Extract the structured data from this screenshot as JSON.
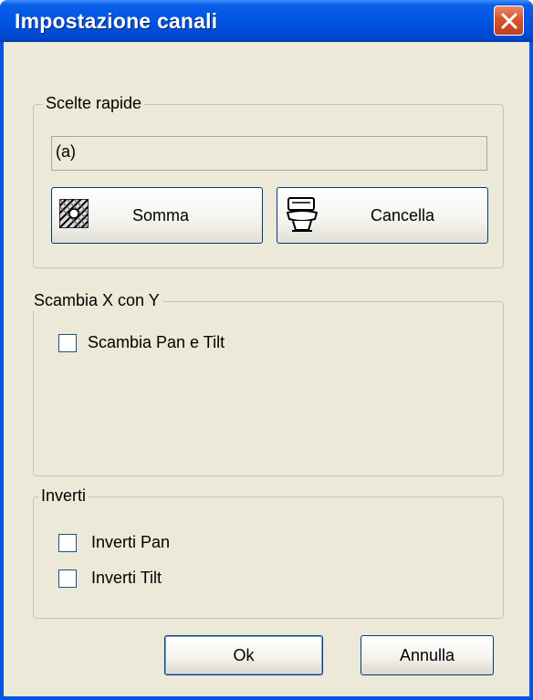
{
  "window": {
    "title": "Impostazione canali"
  },
  "quick_choices": {
    "legend": "Scelte rapide",
    "field_value": "(a)",
    "sum_button_label": "Somma",
    "clear_button_label": "Cancella"
  },
  "swap_xy": {
    "legend": "Scambia X con Y",
    "swap_pan_tilt_label": "Scambia Pan e Tilt",
    "swap_pan_tilt_checked": false
  },
  "invert": {
    "legend": "Inverti",
    "invert_pan_label": "Inverti Pan",
    "invert_pan_checked": false,
    "invert_tilt_label": "Inverti Tilt",
    "invert_tilt_checked": false
  },
  "footer": {
    "ok_label": "Ok",
    "cancel_label": "Annulla"
  },
  "icons": {
    "close": "close-icon",
    "sum": "sum-pattern-icon",
    "clear": "toilet-icon"
  }
}
